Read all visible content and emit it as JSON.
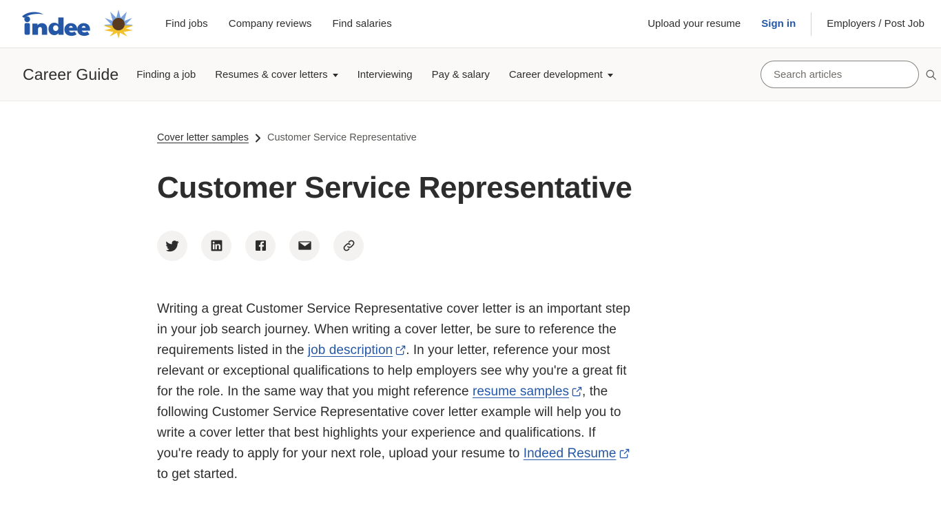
{
  "header": {
    "logo_text": "indeed",
    "logo_icon": "sunflower-icon",
    "nav": [
      {
        "label": "Find jobs",
        "name": "find-jobs"
      },
      {
        "label": "Company reviews",
        "name": "company-reviews"
      },
      {
        "label": "Find salaries",
        "name": "find-salaries"
      }
    ],
    "upload_resume": "Upload your resume",
    "sign_in": "Sign in",
    "employers": "Employers / Post Job"
  },
  "guide_bar": {
    "title": "Career Guide",
    "nav": [
      {
        "label": "Finding a job",
        "dropdown": false
      },
      {
        "label": "Resumes & cover letters",
        "dropdown": true
      },
      {
        "label": "Interviewing",
        "dropdown": false
      },
      {
        "label": "Pay & salary",
        "dropdown": false
      },
      {
        "label": "Career development",
        "dropdown": true
      }
    ],
    "search": {
      "placeholder": "Search articles",
      "value": "",
      "icon": "search-icon"
    }
  },
  "breadcrumb": {
    "parent": "Cover letter samples",
    "separator": "›",
    "current": "Customer Service Representative"
  },
  "article": {
    "title": "Customer Service Representative",
    "share_buttons": [
      {
        "name": "share-twitter-button",
        "icon": "twitter-icon",
        "label": "Twitter"
      },
      {
        "name": "share-linkedin-button",
        "icon": "linkedin-icon",
        "label": "LinkedIn"
      },
      {
        "name": "share-facebook-button",
        "icon": "facebook-icon",
        "label": "Facebook"
      },
      {
        "name": "share-email-button",
        "icon": "email-icon",
        "label": "Email"
      },
      {
        "name": "share-link-button",
        "icon": "link-icon",
        "label": "Copy link"
      }
    ],
    "paragraph": {
      "seg1": "Writing a great Customer Service Representative cover letter is an important step in your job search journey. When writing a cover letter, be sure to reference the requirements listed in the ",
      "link1": "job description",
      "seg2": ". In your letter, reference your most relevant or exceptional qualifications to help employers see why you're a great fit for the role. In the same way that you might reference ",
      "link2": "resume samples",
      "seg3": ", the following Customer Service Representative cover letter example will help you to write a cover letter that best highlights your experience and qualifications. If you're ready to apply for your next role, upload your resume to ",
      "link3": "Indeed Resume",
      "seg4": " to get started."
    }
  },
  "colors": {
    "brand_blue": "#2557a7",
    "link_blue": "#2557a7",
    "text": "#2d2d2d",
    "muted_text": "#595754",
    "guide_bar_bg": "#faf9f8",
    "share_circle_bg": "#f3f2f1",
    "sunflower_petal_blue": "#7aa3dd",
    "sunflower_petal_yellow": "#f2c12e",
    "sunflower_center": "#593a1f"
  }
}
